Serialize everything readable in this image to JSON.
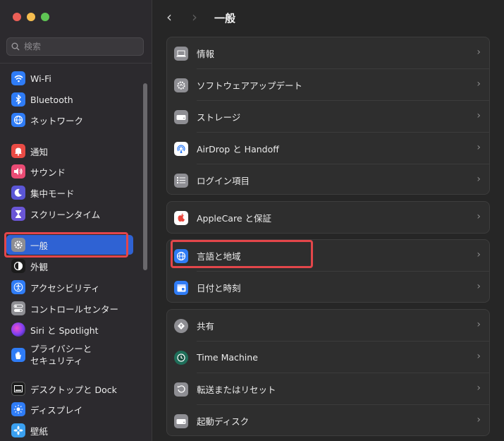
{
  "window": {
    "title": "一般",
    "traffic_colors": [
      "#ec5f57",
      "#f5bd4f",
      "#5fc454"
    ]
  },
  "search": {
    "placeholder": "検索"
  },
  "sidebar": {
    "items": [
      {
        "label": "Wi-Fi",
        "icon": "wifi-icon",
        "color": "#2f7cf6"
      },
      {
        "label": "Bluetooth",
        "icon": "bluetooth-icon",
        "color": "#2f7cf6"
      },
      {
        "label": "ネットワーク",
        "icon": "globe-icon",
        "color": "#2f7cf6"
      },
      {
        "label": "通知",
        "icon": "bell-icon",
        "color": "#ea4b45"
      },
      {
        "label": "サウンド",
        "icon": "speaker-icon",
        "color": "#ea4b74"
      },
      {
        "label": "集中モード",
        "icon": "moon-icon",
        "color": "#5b56d6"
      },
      {
        "label": "スクリーンタイム",
        "icon": "hourglass-icon",
        "color": "#6a56d6"
      },
      {
        "label": "一般",
        "icon": "gear-icon",
        "color": "#8e8e93",
        "selected": true
      },
      {
        "label": "外観",
        "icon": "appearance-icon",
        "color": "#1c1c1c"
      },
      {
        "label": "アクセシビリティ",
        "icon": "accessibility-icon",
        "color": "#2f7cf6"
      },
      {
        "label": "コントロールセンター",
        "icon": "toggles-icon",
        "color": "#8e8e93"
      },
      {
        "label": "Siri と Spotlight",
        "icon": "siri-icon",
        "color": "#7a3ff0"
      },
      {
        "label": "プライバシーと\nセキュリティ",
        "icon": "hand-icon",
        "color": "#2f7cf6"
      },
      {
        "label": "デスクトップと Dock",
        "icon": "dock-icon",
        "color": "#1c1c1c"
      },
      {
        "label": "ディスプレイ",
        "icon": "sun-icon",
        "color": "#2f7cf6"
      },
      {
        "label": "壁紙",
        "icon": "flower-icon",
        "color": "#3aa0f0"
      }
    ]
  },
  "groups": [
    {
      "rows": [
        {
          "label": "情報",
          "icon": "laptop-icon",
          "color": "#8e8e93"
        },
        {
          "label": "ソフトウェアアップデート",
          "icon": "update-gear-icon",
          "color": "#8e8e93"
        },
        {
          "label": "ストレージ",
          "icon": "drive-icon",
          "color": "#8e8e93"
        },
        {
          "label": "AirDrop と Handoff",
          "icon": "airdrop-icon",
          "color": "#ffffff"
        },
        {
          "label": "ログイン項目",
          "icon": "list-icon",
          "color": "#8e8e93"
        }
      ]
    },
    {
      "rows": [
        {
          "label": "AppleCare と保証",
          "icon": "apple-icon",
          "color": "#e8453c"
        }
      ]
    },
    {
      "rows": [
        {
          "label": "言語と地域",
          "icon": "globe-icon",
          "color": "#2f7cf6"
        },
        {
          "label": "日付と時刻",
          "icon": "calendar-icon",
          "color": "#2f7cf6"
        }
      ]
    },
    {
      "rows": [
        {
          "label": "共有",
          "icon": "share-icon",
          "color": "#8e8e93"
        },
        {
          "label": "Time Machine",
          "icon": "time-machine-icon",
          "color": "#1f6f5a"
        },
        {
          "label": "転送またはリセット",
          "icon": "reset-icon",
          "color": "#8e8e93"
        },
        {
          "label": "起動ディスク",
          "icon": "disk-icon",
          "color": "#8e8e93"
        }
      ]
    }
  ]
}
